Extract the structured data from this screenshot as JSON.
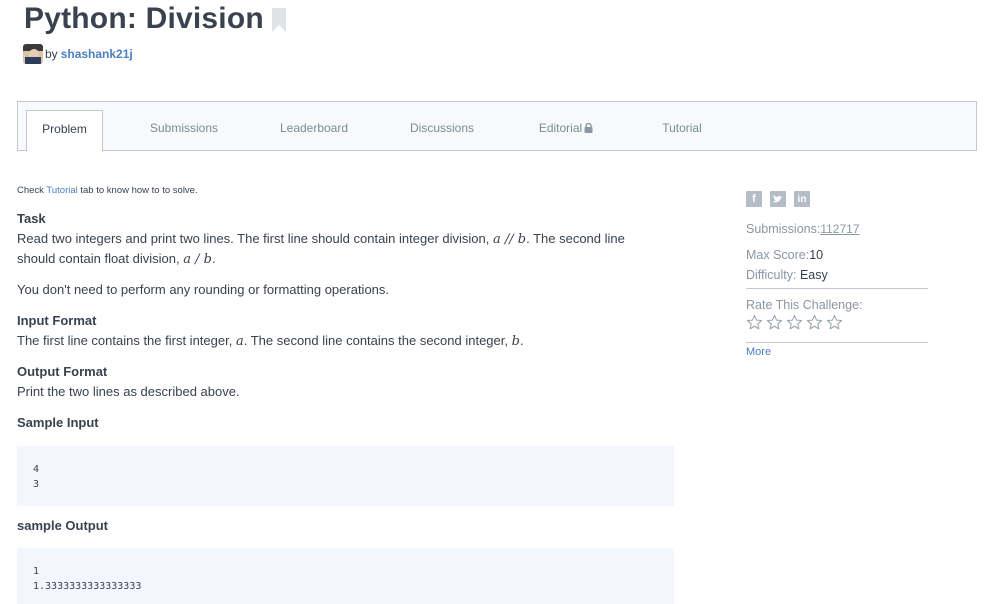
{
  "header": {
    "title": "Python: Division",
    "by_label": "by",
    "author": "shashank21j"
  },
  "tabs": [
    {
      "label": "Problem",
      "active": true
    },
    {
      "label": "Submissions",
      "active": false
    },
    {
      "label": "Leaderboard",
      "active": false
    },
    {
      "label": "Discussions",
      "active": false
    },
    {
      "label": "Editorial",
      "active": false,
      "locked": true
    },
    {
      "label": "Tutorial",
      "active": false
    }
  ],
  "problem": {
    "hint_prefix": "Check",
    "hint_link": "Tutorial",
    "hint_suffix": "tab to know how to to solve.",
    "task_heading": "Task",
    "task_line1_a": "Read two integers and print two lines. The first line should contain integer division,",
    "task_math1": "a // b",
    "task_line1_b": ". The second line",
    "task_line2_a": "should contain float division,",
    "task_math2": "a / b",
    "task_line2_b": ".",
    "note": "You don't need to perform any rounding or formatting operations.",
    "input_heading": "Input Format",
    "input_text_a": "The first line contains the first integer,",
    "input_math_a": "a",
    "input_text_b": ". The second line contains the second integer,",
    "input_math_b": "b",
    "input_text_c": ".",
    "output_heading": "Output Format",
    "output_text": "Print the two lines as described above.",
    "sample_input_heading": "Sample Input",
    "sample_input": [
      "4",
      "3"
    ],
    "sample_output_heading": "sample Output",
    "sample_output": [
      "1",
      "1.3333333333333333"
    ]
  },
  "sidebar": {
    "social": [
      "facebook-icon",
      "twitter-icon",
      "linkedin-icon"
    ],
    "submissions_label": "Submissions:",
    "submissions_value": "112717",
    "max_score_label": "Max Score:",
    "max_score_value": "10",
    "difficulty_label": "Difficulty:",
    "difficulty_value": "Easy",
    "rate_label": "Rate This Challenge:",
    "rating": 0,
    "rating_max": 5,
    "more_label": "More"
  },
  "colors": {
    "text": "#39424e",
    "link": "#4a7fc1",
    "muted": "#8b96a3",
    "code_bg": "#f3f7fd",
    "border": "#c2c7d0"
  }
}
